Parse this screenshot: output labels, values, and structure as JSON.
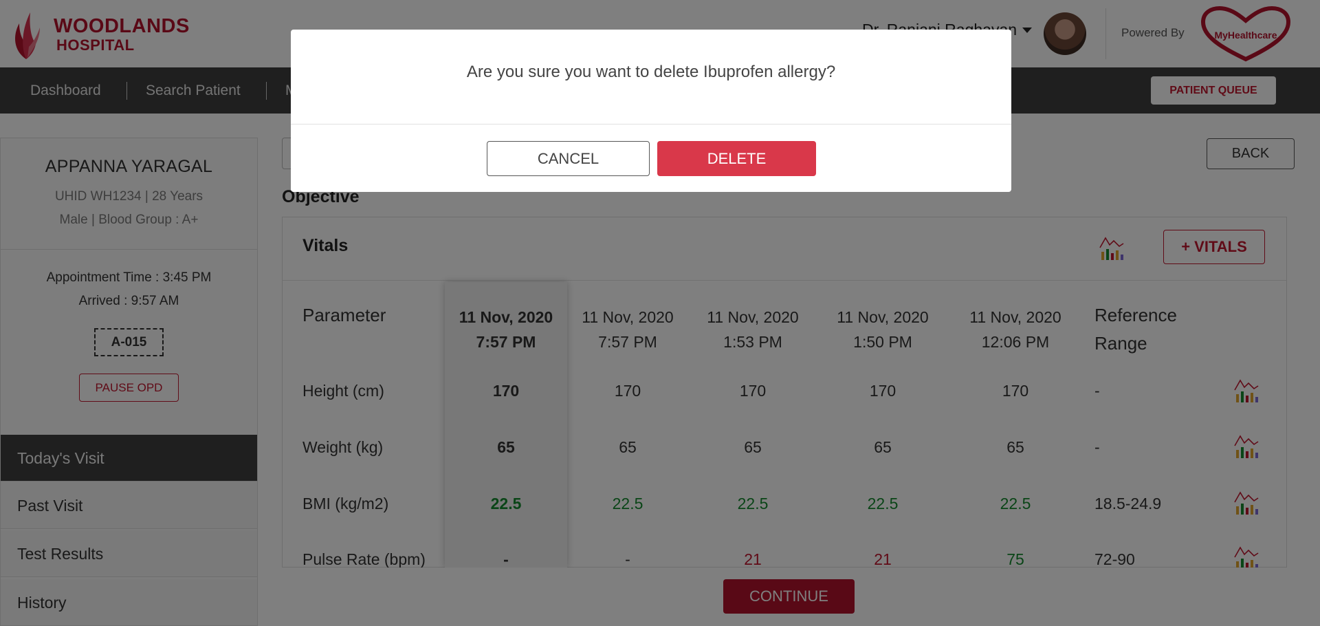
{
  "header": {
    "hospital_line1": "WOODLANDS",
    "hospital_line2": "HOSPITAL",
    "doctor_name": "Dr. Ranjani Raghavan",
    "powered_by": "Powered By",
    "partner_logo_text": "MyHealthcare",
    "brand_color": "#b5122c"
  },
  "nav": {
    "items": [
      "Dashboard",
      "Search Patient",
      "M"
    ],
    "patient_queue": "PATIENT QUEUE"
  },
  "patient": {
    "name": "APPANNA YARAGAL",
    "uhid_line": "UHID WH1234 | 28 Years",
    "gender_line": "Male | Blood Group : A+",
    "appointment_time": "Appointment Time : 3:45 PM",
    "arrived": "Arrived : 9:57 AM",
    "token": "A-015",
    "pause_label": "PAUSE OPD"
  },
  "sidebar": {
    "items": [
      "Today's Visit",
      "Past Visit",
      "Test Results",
      "History"
    ]
  },
  "main": {
    "back_label": "BACK",
    "section_title": "Objective",
    "vitals_title": "Vitals",
    "add_vitals_label": "+ VITALS",
    "continue_label": "CONTINUE"
  },
  "vitals_table": {
    "param_header": "Parameter",
    "ref_header_1": "Reference",
    "ref_header_2": "Range",
    "columns": [
      {
        "date": "11 Nov, 2020",
        "time": "7:57 PM"
      },
      {
        "date": "11 Nov, 2020",
        "time": "7:57 PM"
      },
      {
        "date": "11 Nov, 2020",
        "time": "1:53 PM"
      },
      {
        "date": "11 Nov, 2020",
        "time": "1:50 PM"
      },
      {
        "date": "11 Nov, 2020",
        "time": "12:06 PM"
      }
    ],
    "rows": [
      {
        "param": "Height (cm)",
        "values": [
          "170",
          "170",
          "170",
          "170",
          "170"
        ],
        "ref": "-"
      },
      {
        "param": "Weight (kg)",
        "values": [
          "65",
          "65",
          "65",
          "65",
          "65"
        ],
        "ref": "-"
      },
      {
        "param": "BMI (kg/m2)",
        "values": [
          "22.5",
          "22.5",
          "22.5",
          "22.5",
          "22.5"
        ],
        "ref": "18.5-24.9"
      },
      {
        "param": "Pulse Rate (bpm)",
        "values": [
          "-",
          "-",
          "21",
          "21",
          "75"
        ],
        "ref": "72-90"
      }
    ],
    "status_colors": {
      "normal": "#148a2e",
      "abnormal": "#c0162f"
    }
  },
  "modal": {
    "message": "Are you sure you want to delete Ibuprofen allergy?",
    "cancel_label": "CANCEL",
    "delete_label": "DELETE"
  }
}
